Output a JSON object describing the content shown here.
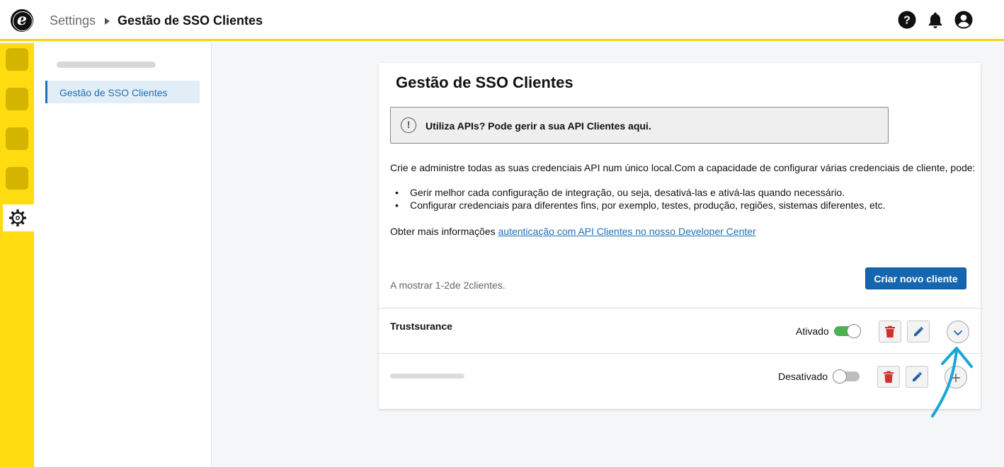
{
  "header": {
    "breadcrumb_root": "Settings",
    "breadcrumb_current": "Gestão de SSO Clientes",
    "icons": [
      "help-icon",
      "bell-icon",
      "user-icon"
    ]
  },
  "sidebar": {
    "items": [
      {
        "label": "Gestão de SSO Clientes",
        "active": true
      }
    ]
  },
  "page": {
    "title": "Gestão de SSO Clientes",
    "notice": "Utiliza APIs? Pode gerir a sua API Clientes aqui.",
    "description": "Crie e administre todas as suas credenciais API num único local.Com a capacidade de configurar várias credenciais de cliente, pode:",
    "bullets": [
      "Gerir melhor cada configuração de integração, ou seja, desativá-las e ativá-las quando necessário.",
      "Configurar credenciais para diferentes fins, por exemplo, testes, produção, regiões, sistemas diferentes, etc."
    ],
    "more_prefix": "Obter mais informações ",
    "more_link": "autenticação com API Clientes no nosso Developer Center",
    "count_text": "A mostrar 1-2de 2clientes.",
    "create_button": "Criar novo cliente"
  },
  "clients": [
    {
      "name": "Trustsurance",
      "status": "Ativado",
      "enabled": true
    },
    {
      "name": "",
      "status": "Desativado",
      "enabled": false
    }
  ],
  "colors": {
    "brand_yellow": "#fedc0f",
    "primary_blue": "#1566b0",
    "toggle_on": "#4caf50",
    "delete_red": "#d32f2f",
    "annotation_cyan": "#1aa6d6"
  }
}
